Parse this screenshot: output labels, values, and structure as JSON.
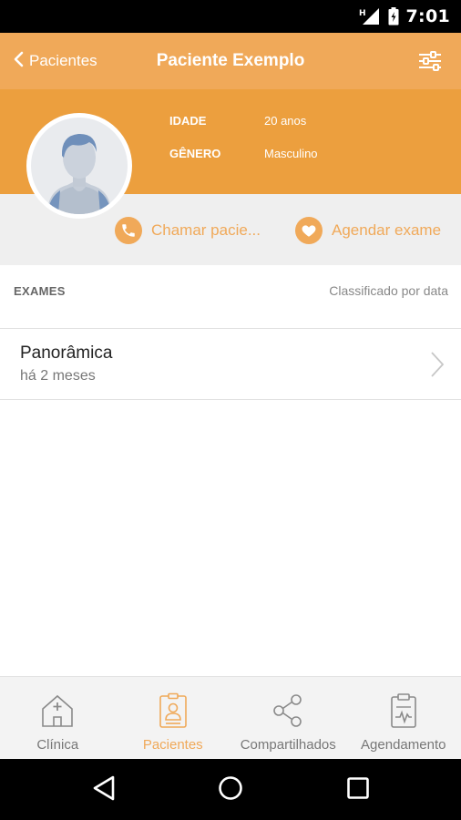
{
  "status_bar": {
    "time": "7:01",
    "network": "H"
  },
  "header": {
    "back_label": "Pacientes",
    "title": "Paciente Exemplo"
  },
  "profile": {
    "fields": [
      {
        "key": "IDADE",
        "value": "20 anos"
      },
      {
        "key": "GÊNERO",
        "value": "Masculino"
      }
    ]
  },
  "actions": {
    "call_label": "Chamar pacie...",
    "schedule_label": "Agendar exame"
  },
  "exams": {
    "section_label": "EXAMES",
    "sort_label": "Classificado por data",
    "items": [
      {
        "name": "Panorâmica",
        "date": "há 2 meses"
      }
    ]
  },
  "bottom_nav": [
    {
      "label": "Clínica",
      "icon": "clinic-icon"
    },
    {
      "label": "Pacientes",
      "icon": "patients-icon",
      "active": true
    },
    {
      "label": "Compartilhados",
      "icon": "share-icon"
    },
    {
      "label": "Agendamento",
      "icon": "schedule-icon"
    }
  ],
  "colors": {
    "accent": "#f0a959",
    "profile_bg": "#ec9f3e",
    "topbar_bg": "#f0a959",
    "actions_bg": "#efefef"
  }
}
